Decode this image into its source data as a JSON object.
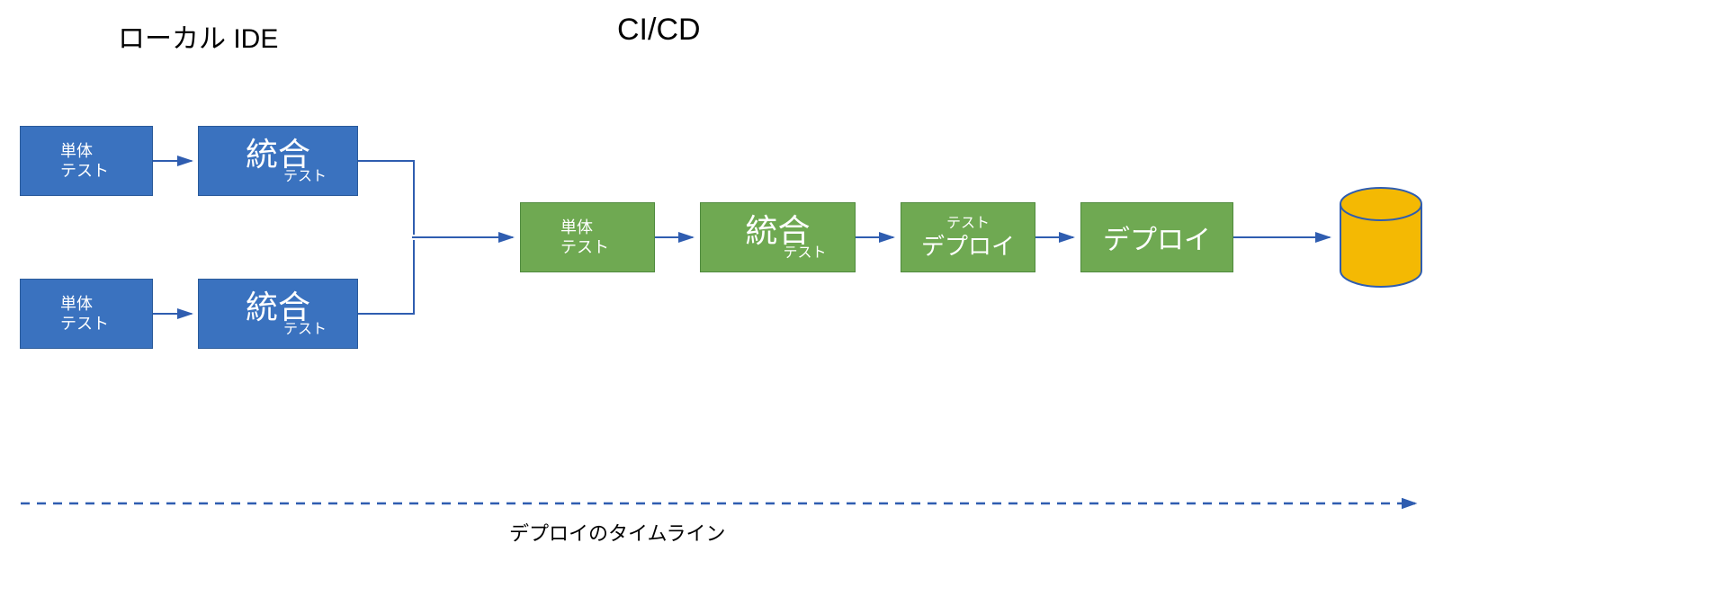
{
  "headings": {
    "local_ide": "ローカル IDE",
    "ci_cd": "CI/CD"
  },
  "boxes": {
    "unit_test": {
      "l1": "単体",
      "l2": "テスト"
    },
    "integration_test": {
      "big": "統合",
      "sub": "テスト"
    },
    "test_deploy": {
      "l1": "テスト",
      "l2": "デプロイ"
    },
    "deploy": {
      "big": "デプロイ"
    }
  },
  "timeline_label": "デプロイのタイムライン",
  "colors": {
    "blue_box": "#3a72bf",
    "green_box": "#6fa952",
    "arrow": "#2f5db0",
    "cylinder": "#f4b903",
    "cylinder_stroke": "#2f5db0"
  }
}
